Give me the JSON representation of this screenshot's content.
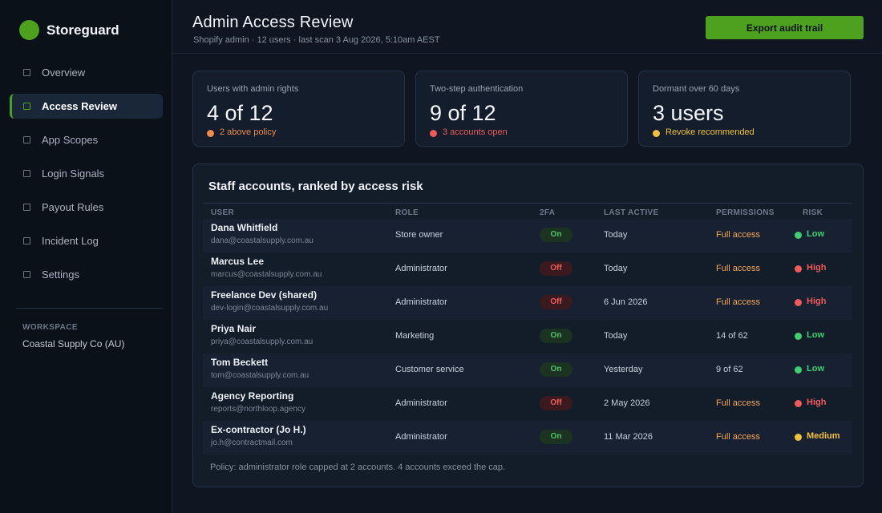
{
  "brand": {
    "name": "Storeguard",
    "logo_color": "#4ea11f"
  },
  "sidebar": {
    "items": [
      {
        "label": "Overview",
        "active": false
      },
      {
        "label": "Access Review",
        "active": true
      },
      {
        "label": "App Scopes",
        "active": false
      },
      {
        "label": "Login Signals",
        "active": false
      },
      {
        "label": "Payout Rules",
        "active": false
      },
      {
        "label": "Incident Log",
        "active": false
      },
      {
        "label": "Settings",
        "active": false
      }
    ],
    "workspace_label": "WORKSPACE",
    "workspace_name": "Coastal Supply Co (AU)"
  },
  "header": {
    "title": "Admin Access Review",
    "subtitle": "Shopify admin  ·  12 users  ·  last scan 3 Aug 2026, 5:10am AEST",
    "export_label": "Export audit trail"
  },
  "stats": [
    {
      "label": "Users with admin rights",
      "value": "4 of 12",
      "note": "2 above policy",
      "note_color": "#f08a4b"
    },
    {
      "label": "Two-step authentication",
      "value": "9 of 12",
      "note": "3 accounts open",
      "note_color": "#ef5b5b"
    },
    {
      "label": "Dormant over 60 days",
      "value": "3 users",
      "note": "Revoke recommended",
      "note_color": "#f2c13c"
    }
  ],
  "table": {
    "title": "Staff accounts, ranked by access risk",
    "headers": [
      "USER",
      "ROLE",
      "2FA",
      "LAST ACTIVE",
      "PERMISSIONS",
      "RISK"
    ],
    "rows": [
      {
        "name": "Dana Whitfield",
        "email": "dana@coastalsupply.com.au",
        "role": "Store owner",
        "twofa": "On",
        "last_active": "Today",
        "permissions": "Full access",
        "risk": "Low"
      },
      {
        "name": "Marcus Lee",
        "email": "marcus@coastalsupply.com.au",
        "role": "Administrator",
        "twofa": "Off",
        "last_active": "Today",
        "permissions": "Full access",
        "risk": "High"
      },
      {
        "name": "Freelance Dev (shared)",
        "email": "dev-login@coastalsupply.com.au",
        "role": "Administrator",
        "twofa": "Off",
        "last_active": "6 Jun 2026",
        "permissions": "Full access",
        "risk": "High"
      },
      {
        "name": "Priya Nair",
        "email": "priya@coastalsupply.com.au",
        "role": "Marketing",
        "twofa": "On",
        "last_active": "Today",
        "permissions": "14 of 62",
        "risk": "Low"
      },
      {
        "name": "Tom Beckett",
        "email": "tom@coastalsupply.com.au",
        "role": "Customer service",
        "twofa": "On",
        "last_active": "Yesterday",
        "permissions": "9 of 62",
        "risk": "Low"
      },
      {
        "name": "Agency Reporting",
        "email": "reports@northloop.agency",
        "role": "Administrator",
        "twofa": "Off",
        "last_active": "2 May 2026",
        "permissions": "Full access",
        "risk": "High"
      },
      {
        "name": "Ex-contractor (Jo H.)",
        "email": "jo.h@contractmail.com",
        "role": "Administrator",
        "twofa": "On",
        "last_active": "11 Mar 2026",
        "permissions": "Full access",
        "risk": "Medium"
      }
    ],
    "footnote": "Policy: administrator role capped at 2 accounts. 4 accounts exceed the cap."
  },
  "colors": {
    "accent": "#4ea11f",
    "risk_low": "#3ecf6e",
    "risk_high": "#ef5b5b",
    "risk_medium": "#f2c13c",
    "permission_full": "#f4a65a"
  }
}
